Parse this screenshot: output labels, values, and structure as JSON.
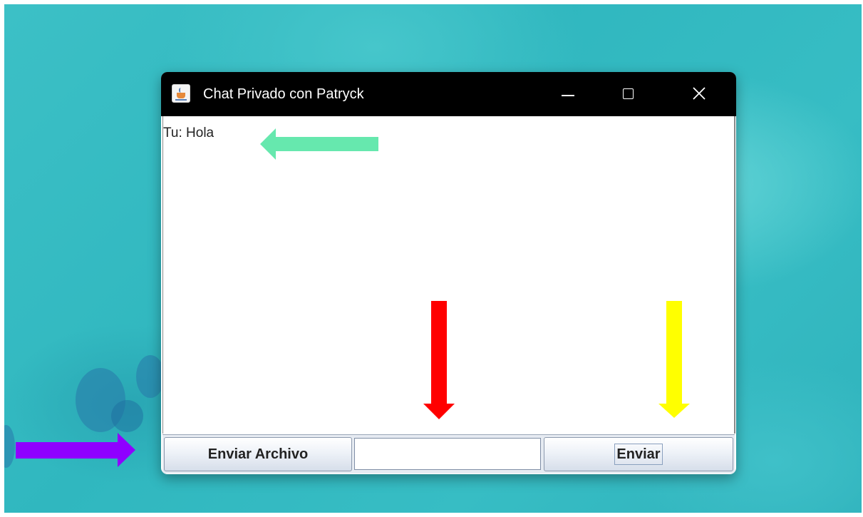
{
  "window": {
    "title": "Chat Privado con Patryck",
    "app_icon": "java-cup-icon"
  },
  "titlebar_controls": {
    "minimize_icon": "minimize-icon",
    "maximize_icon": "maximize-icon",
    "close_icon": "close-icon"
  },
  "chat": {
    "messages": [
      "Tu: Hola"
    ]
  },
  "controls": {
    "send_file_label": "Enviar Archivo",
    "message_value": "",
    "send_label": "Enviar"
  },
  "annotations": [
    {
      "name": "green-arrow",
      "direction": "left",
      "color": "#66e8ae"
    },
    {
      "name": "red-arrow",
      "direction": "down",
      "color": "#ff0000"
    },
    {
      "name": "yellow-arrow",
      "direction": "down",
      "color": "#ffff00"
    },
    {
      "name": "purple-arrow",
      "direction": "right",
      "color": "#8f00ff"
    }
  ],
  "colors": {
    "titlebar": "#000000",
    "desktop": "#37bdc4"
  }
}
